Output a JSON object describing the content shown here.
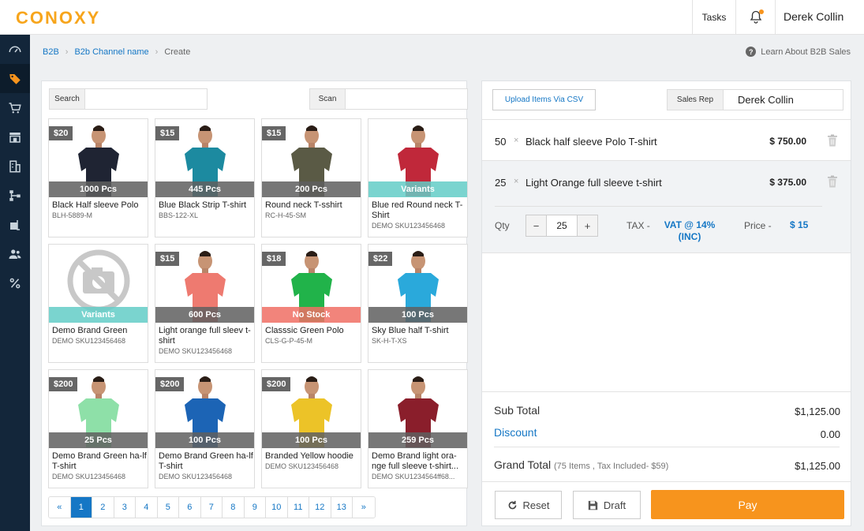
{
  "app": {
    "logo": "CONOXY"
  },
  "topbar": {
    "tasks_label": "Tasks",
    "user_name": "Derek Collin"
  },
  "sidebar": {
    "items": [
      {
        "icon": "dashboard-icon"
      },
      {
        "icon": "tag-icon",
        "active": true
      },
      {
        "icon": "cart-icon"
      },
      {
        "icon": "store-icon"
      },
      {
        "icon": "building-icon"
      },
      {
        "icon": "hierarchy-icon"
      },
      {
        "icon": "warehouse-icon"
      },
      {
        "icon": "users-icon"
      },
      {
        "icon": "percent-icon"
      }
    ]
  },
  "breadcrumb": {
    "level1": "B2B",
    "level2": "B2b Channel name",
    "current": "Create"
  },
  "help": {
    "label": "Learn About B2B Sales"
  },
  "search": {
    "label": "Search",
    "value": ""
  },
  "scan": {
    "label": "Scan",
    "value": ""
  },
  "products": [
    {
      "price": "$20",
      "stock": "1000 Pcs",
      "stock_type": "count",
      "name": "Black Half sleeve Polo",
      "sku": "BLH-5889-M",
      "shirt_color": "#1f2433",
      "has_image": true
    },
    {
      "price": "$15",
      "stock": "445 Pcs",
      "stock_type": "count",
      "name": "Blue Black Strip T-shirt",
      "sku": "BBS-122-XL",
      "shirt_color": "#1c8aa0",
      "has_image": true
    },
    {
      "price": "$15",
      "stock": "200 Pcs",
      "stock_type": "count",
      "name": "Round neck T-sshirt",
      "sku": "RC-H-45-SM",
      "shirt_color": "#5a5a45",
      "has_image": true
    },
    {
      "price": "",
      "stock": "Variants",
      "stock_type": "variants",
      "name": "Blue red Round neck T-Shirt",
      "sku": "DEMO SKU123456468",
      "shirt_color": "#c0283a",
      "has_image": true
    },
    {
      "price": "",
      "stock": "Variants",
      "stock_type": "variants",
      "name": "Demo Brand Green",
      "sku": "DEMO SKU123456468",
      "shirt_color": "",
      "has_image": false
    },
    {
      "price": "$15",
      "stock": "600 Pcs",
      "stock_type": "count",
      "name": "Light orange full sleev t-shirt",
      "sku": "DEMO SKU123456468",
      "shirt_color": "#ee7a70",
      "has_image": true
    },
    {
      "price": "$18",
      "stock": "No Stock",
      "stock_type": "nostock",
      "name": "Classsic Green Polo",
      "sku": "CLS-G-P-45-M",
      "shirt_color": "#21b34a",
      "has_image": true
    },
    {
      "price": "$22",
      "stock": "100 Pcs",
      "stock_type": "count",
      "name": "Sky Blue half T-shirt",
      "sku": "SK-H-T-XS",
      "shirt_color": "#2aa9db",
      "has_image": true
    },
    {
      "price": "$200",
      "stock": "25 Pcs",
      "stock_type": "count",
      "name": "Demo Brand Green ha-lf T-shirt",
      "sku": "DEMO SKU123456468",
      "shirt_color": "#8ee0a8",
      "has_image": true
    },
    {
      "price": "$200",
      "stock": "100 Pcs",
      "stock_type": "count",
      "name": "Demo Brand Green ha-lf T-shirt",
      "sku": "DEMO SKU123456468",
      "shirt_color": "#1c64b5",
      "has_image": true
    },
    {
      "price": "$200",
      "stock": "100 Pcs",
      "stock_type": "count",
      "name": "Branded Yellow hoodie",
      "sku": "DEMO SKU123456468",
      "shirt_color": "#ecc328",
      "has_image": true
    },
    {
      "price": "",
      "stock": "259 Pcs",
      "stock_type": "count",
      "name": "Demo Brand light ora-nge full sleeve t-shirt...",
      "sku": "DEMO SKU1234564ff68...",
      "shirt_color": "#8a1e2b",
      "has_image": true
    }
  ],
  "pagination": {
    "prev": "«",
    "next": "»",
    "pages": [
      "1",
      "2",
      "3",
      "4",
      "5",
      "6",
      "7",
      "8",
      "9",
      "10",
      "11",
      "12",
      "13"
    ],
    "current": "1"
  },
  "order": {
    "upload_label": "Upload Items Via CSV",
    "sales_rep_label": "Sales Rep",
    "sales_rep_value": "Derek Collin",
    "x_symbol": "×",
    "items": [
      {
        "qty": "50",
        "name": "Black half sleeve Polo T-shirt",
        "price": "$ 750.00"
      },
      {
        "qty": "25",
        "name": "Light Orange full sleeve t-shirt",
        "price": "$ 375.00"
      }
    ],
    "editor": {
      "qty_label": "Qty",
      "minus": "−",
      "plus": "+",
      "qty_value": "25",
      "tax_label": "TAX -",
      "tax_value": "VAT @ 14% (INC)",
      "price_label": "Price  -",
      "price_value": "$ 15"
    },
    "subtotal_label": "Sub Total",
    "subtotal_value": "$1,125.00",
    "discount_label": "Discount",
    "discount_value": "0.00",
    "grand_total_label": "Grand Total",
    "grand_total_note": "(75 Items , Tax Included- $59)",
    "grand_total_value": "$1,125.00",
    "reset_label": "Reset",
    "draft_label": "Draft",
    "pay_label": "Pay"
  },
  "colors": {
    "brand": "#f7a51c",
    "link": "#1577c5",
    "pay": "#f7941d",
    "sidebar": "#13263a",
    "variants": "#63cdc7",
    "nostock": "#f06e64"
  }
}
